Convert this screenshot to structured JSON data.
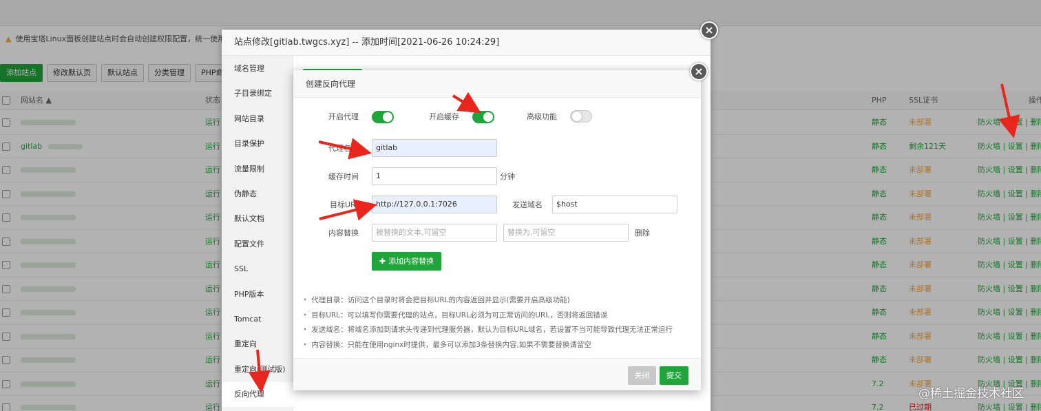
{
  "background": {
    "notice": "使用宝塔Linux面板创建站点时会自动创建权限配置，统一使用",
    "buttons": [
      "添加站点",
      "修改默认页",
      "默认站点",
      "分类管理",
      "PHP命令"
    ],
    "columns": {
      "name": "网站名 ▲",
      "status": "状态",
      "php": "PHP",
      "ssl": "SSL证书",
      "ops": "操作"
    },
    "rows": [
      {
        "name": "",
        "status": "运行",
        "php": "静态",
        "ssl": "未部署",
        "ops": "防火墙 | 设置 | 删除"
      },
      {
        "name": "gitlab",
        "status": "运行",
        "php": "静态",
        "ssl": "剩余121天",
        "ops": "防火墙 | 设置 | 删除"
      },
      {
        "name": "",
        "status": "运行",
        "php": "静态",
        "ssl": "未部署",
        "ops": "防火墙 | 设置 | 删除"
      },
      {
        "name": "",
        "status": "运行",
        "php": "静态",
        "ssl": "未部署",
        "ops": "防火墙 | 设置 | 删除"
      },
      {
        "name": "",
        "status": "运行",
        "php": "静态",
        "ssl": "未部署",
        "ops": "防火墙 | 设置 | 删除"
      },
      {
        "name": "",
        "status": "运行",
        "php": "静态",
        "ssl": "未部署",
        "ops": "防火墙 | 设置 | 删除"
      },
      {
        "name": "",
        "status": "运行",
        "php": "静态",
        "ssl": "未部署",
        "ops": "防火墙 | 设置 | 删除"
      },
      {
        "name": "",
        "status": "运行",
        "php": "静态",
        "ssl": "未部署",
        "ops": "防火墙 | 设置 | 删除"
      },
      {
        "name": "",
        "status": "运行",
        "php": "静态",
        "ssl": "未部署",
        "ops": "防火墙 | 设置 | 删除"
      },
      {
        "name": "",
        "status": "运行",
        "php": "静态",
        "ssl": "未部署",
        "ops": "防火墙 | 设置 | 删除"
      },
      {
        "name": "",
        "status": "运行",
        "php": "静态",
        "ssl": "未部署",
        "ops": "防火墙 | 设置 | 删除"
      },
      {
        "name": "",
        "status": "运行",
        "php": "7.2",
        "ssl": "未部署",
        "ops": "防火墙 | 设置 | 删除"
      },
      {
        "name": "",
        "status": "运行",
        "php": "7.2",
        "ssl": "已过期",
        "ops": "防火墙 | 设置 | 删除"
      }
    ]
  },
  "site_modal": {
    "title": "站点修改[gitlab.twgcs.xyz] -- 添加时间[2021-06-26 10:24:29]",
    "menu": [
      "域名管理",
      "子目录绑定",
      "网站目录",
      "目录保护",
      "流量限制",
      "伪静态",
      "默认文档",
      "配置文件",
      "SSL",
      "PHP版本",
      "Tomcat",
      "重定向",
      "重定向(测试版)",
      "反向代理"
    ],
    "active_menu": "反向代理"
  },
  "proxy_modal": {
    "title": "创建反向代理",
    "enable_proxy_label": "开启代理",
    "enable_proxy": true,
    "enable_cache_label": "开启缓存",
    "enable_cache": true,
    "advanced_label": "高级功能",
    "advanced": false,
    "proxy_name_label": "代理名称",
    "proxy_name": "gitlab",
    "cache_time_label": "缓存时间",
    "cache_time": "1",
    "cache_unit": "分钟",
    "target_url_label": "目标URL",
    "target_url": "http://127.0.0.1:7026",
    "send_domain_label": "发送域名",
    "send_domain": "$host",
    "replace_label": "内容替换",
    "replace_from_placeholder": "被替换的文本,可留空",
    "replace_to_placeholder": "替换为,可留空",
    "delete_label": "删除",
    "add_replace_label": "添加内容替换",
    "tips": [
      "代理目录：访问这个目录时将会把目标URL的内容返回并显示(需要开启高级功能)",
      "目标URL：可以填写你需要代理的站点，目标URL必须为可正常访问的URL，否则将返回错误",
      "发送域名：将域名添加到请求头传递到代理服务器，默认为目标URL域名，若设置不当可能导致代理无法正常运行",
      "内容替换：只能在使用nginx时提供，最多可以添加3条替换内容,如果不需要替换请留空"
    ],
    "close_label": "关闭",
    "submit_label": "提交"
  },
  "watermark": "@稀土掘金技术社区",
  "colors": {
    "accent": "#20a53a",
    "warning": "#f0ad4e",
    "danger": "#ef0808",
    "arrow": "#e8261d"
  }
}
